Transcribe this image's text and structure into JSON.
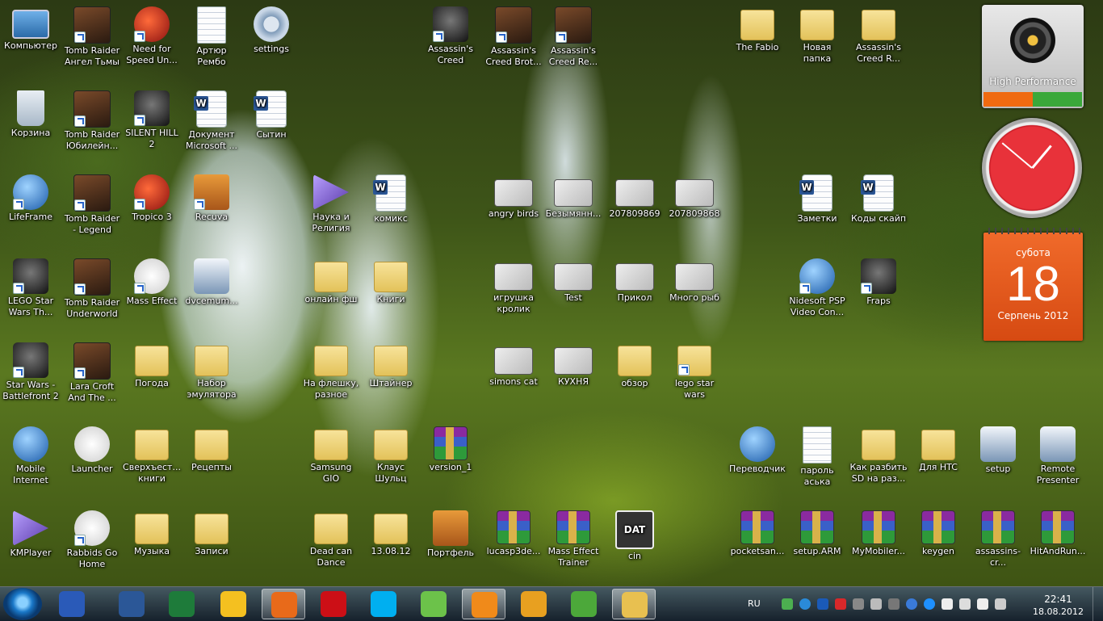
{
  "desktop_icons": [
    {
      "label": "Компьютер",
      "kind": "pc",
      "icon": "computer-icon",
      "shortcut": false
    },
    {
      "label": "Tomb Raider Ангел Тьмы",
      "kind": "game",
      "icon": "game-icon",
      "shortcut": true
    },
    {
      "label": "Need for Speed Un...",
      "kind": "red",
      "icon": "nfs-icon",
      "shortcut": true
    },
    {
      "label": "Артюр Рембо",
      "kind": "doc",
      "icon": "text-document-icon",
      "shortcut": false
    },
    {
      "label": "settings",
      "kind": "gear",
      "icon": "settings-file-icon",
      "shortcut": false
    },
    {
      "label": "Корзина",
      "kind": "trash",
      "icon": "recycle-bin-icon",
      "shortcut": false
    },
    {
      "label": "Tomb Raider Юбилейн...",
      "kind": "game",
      "icon": "game-icon",
      "shortcut": true
    },
    {
      "label": "SILENT HILL 2",
      "kind": "dark",
      "icon": "game-icon",
      "shortcut": true
    },
    {
      "label": "Документ Microsoft ...",
      "kind": "word",
      "icon": "word-document-icon",
      "shortcut": false
    },
    {
      "label": "Сытин",
      "kind": "word",
      "icon": "word-document-icon",
      "shortcut": false
    },
    {
      "label": "LifeFrame",
      "kind": "app",
      "icon": "lifeframe-icon",
      "shortcut": true
    },
    {
      "label": "Tomb Raider - Legend",
      "kind": "game",
      "icon": "game-icon",
      "shortcut": true
    },
    {
      "label": "Tropico 3",
      "kind": "red",
      "icon": "tropico-icon",
      "shortcut": true
    },
    {
      "label": "Recuva",
      "kind": "cart",
      "icon": "recuva-icon",
      "shortcut": true
    },
    {
      "label": "Наука и Религия",
      "kind": "purple",
      "icon": "djvu-icon",
      "shortcut": false
    },
    {
      "label": "комикс",
      "kind": "word",
      "icon": "word-document-icon",
      "shortcut": false
    },
    {
      "label": "LEGO Star Wars Th...",
      "kind": "dark",
      "icon": "game-icon",
      "shortcut": true
    },
    {
      "label": "Tomb Raider Underworld",
      "kind": "game",
      "icon": "game-icon",
      "shortcut": true
    },
    {
      "label": "Mass Effect",
      "kind": "white",
      "icon": "mass-effect-icon",
      "shortcut": true
    },
    {
      "label": "dvcemum...",
      "kind": "shell",
      "icon": "emulator-icon",
      "shortcut": false
    },
    {
      "label": "онлайн фш",
      "kind": "folder",
      "icon": "folder-icon",
      "shortcut": false
    },
    {
      "label": "Книги",
      "kind": "folder",
      "icon": "folder-icon",
      "shortcut": false
    },
    {
      "label": "Star Wars - Battlefront 2",
      "kind": "dark",
      "icon": "game-icon",
      "shortcut": true
    },
    {
      "label": "Lara Croft And The ...",
      "kind": "game",
      "icon": "game-icon",
      "shortcut": true
    },
    {
      "label": "Погода",
      "kind": "folder",
      "icon": "folder-icon",
      "shortcut": false
    },
    {
      "label": "Набор эмулятора",
      "kind": "folder",
      "icon": "folder-icon",
      "shortcut": false
    },
    {
      "label": "На флешку, разное",
      "kind": "folder",
      "icon": "folder-icon",
      "shortcut": false
    },
    {
      "label": "Штайнер",
      "kind": "folder",
      "icon": "folder-icon",
      "shortcut": false
    },
    {
      "label": "Mobile Internet",
      "kind": "app",
      "icon": "globe-icon",
      "shortcut": false
    },
    {
      "label": "Launcher",
      "kind": "white",
      "icon": "launcher-icon",
      "shortcut": false
    },
    {
      "label": "Сверхъест... книги",
      "kind": "folder",
      "icon": "folder-icon",
      "shortcut": false
    },
    {
      "label": "Рецепты",
      "kind": "folder",
      "icon": "folder-icon",
      "shortcut": false
    },
    {
      "label": "Samsung GIO",
      "kind": "folder",
      "icon": "folder-icon",
      "shortcut": false
    },
    {
      "label": "Клаус Шульц",
      "kind": "folder",
      "icon": "folder-icon",
      "shortcut": false
    },
    {
      "label": "version_1",
      "kind": "rar",
      "icon": "rar-archive-icon",
      "shortcut": false
    },
    {
      "label": "KMPlayer",
      "kind": "purple",
      "icon": "kmplayer-icon",
      "shortcut": false
    },
    {
      "label": "Rabbids Go Home",
      "kind": "white",
      "icon": "rabbids-icon",
      "shortcut": true
    },
    {
      "label": "Музыка",
      "kind": "folder",
      "icon": "folder-icon",
      "shortcut": false
    },
    {
      "label": "Записи",
      "kind": "folder",
      "icon": "folder-icon",
      "shortcut": false
    },
    {
      "label": "Dead can Dance",
      "kind": "folder",
      "icon": "folder-icon",
      "shortcut": false
    },
    {
      "label": "13.08.12",
      "kind": "folder",
      "icon": "folder-icon",
      "shortcut": false
    },
    {
      "label": "Портфель",
      "kind": "cart",
      "icon": "briefcase-icon",
      "shortcut": false
    },
    {
      "label": "Assassin's Creed",
      "kind": "dark",
      "icon": "ubisoft-icon",
      "shortcut": true
    },
    {
      "label": "Assassin's Creed Brot...",
      "kind": "game",
      "icon": "game-icon",
      "shortcut": true
    },
    {
      "label": "Assassin's Creed Re...",
      "kind": "game",
      "icon": "game-icon",
      "shortcut": true
    },
    {
      "label": "angry birds",
      "kind": "img",
      "icon": "image-icon",
      "shortcut": false
    },
    {
      "label": "Безымянн...",
      "kind": "img",
      "icon": "image-icon",
      "shortcut": false
    },
    {
      "label": "207809869",
      "kind": "img",
      "icon": "image-icon",
      "shortcut": false
    },
    {
      "label": "207809868",
      "kind": "img",
      "icon": "image-icon",
      "shortcut": false
    },
    {
      "label": "игрушка кролик",
      "kind": "img",
      "icon": "image-icon",
      "shortcut": false
    },
    {
      "label": "Test",
      "kind": "img",
      "icon": "image-icon",
      "shortcut": false
    },
    {
      "label": "Прикол",
      "kind": "img",
      "icon": "image-icon",
      "shortcut": false
    },
    {
      "label": "Много рыб",
      "kind": "img",
      "icon": "image-icon",
      "shortcut": false
    },
    {
      "label": "simons cat",
      "kind": "img",
      "icon": "image-icon",
      "shortcut": false
    },
    {
      "label": "КУХНЯ",
      "kind": "img",
      "icon": "image-icon",
      "shortcut": false
    },
    {
      "label": "обзор",
      "kind": "folder",
      "icon": "folder-icon",
      "shortcut": false
    },
    {
      "label": "lego star wars",
      "kind": "folder",
      "icon": "folder-icon",
      "shortcut": true
    },
    {
      "label": "lucasp3de...",
      "kind": "rar",
      "icon": "rar-archive-icon",
      "shortcut": false
    },
    {
      "label": "Mass Effect Trainer",
      "kind": "rar",
      "icon": "rar-archive-icon",
      "shortcut": false
    },
    {
      "label": "cin",
      "kind": "dat",
      "icon": "dat-file-icon",
      "shortcut": false
    },
    {
      "label": "The Fabio",
      "kind": "folder",
      "icon": "folder-icon",
      "shortcut": false
    },
    {
      "label": "Новая папка",
      "kind": "folder",
      "icon": "folder-icon",
      "shortcut": false
    },
    {
      "label": "Assassin's Creed R...",
      "kind": "folder",
      "icon": "folder-icon",
      "shortcut": false
    },
    {
      "label": "Заметки",
      "kind": "word",
      "icon": "word-document-icon",
      "shortcut": false
    },
    {
      "label": "Коды скайп",
      "kind": "word",
      "icon": "word-document-icon",
      "shortcut": false
    },
    {
      "label": "Nidesoft PSP Video Con...",
      "kind": "app",
      "icon": "video-converter-icon",
      "shortcut": true
    },
    {
      "label": "Fraps",
      "kind": "dark",
      "icon": "fraps-icon",
      "shortcut": true
    },
    {
      "label": "Переводчик",
      "kind": "app",
      "icon": "translator-icon",
      "shortcut": false
    },
    {
      "label": "пароль аська",
      "kind": "doc",
      "icon": "text-document-icon",
      "shortcut": false
    },
    {
      "label": "Как разбить SD на раз...",
      "kind": "folder",
      "icon": "folder-icon",
      "shortcut": false
    },
    {
      "label": "Для HTC",
      "kind": "folder",
      "icon": "folder-icon",
      "shortcut": false
    },
    {
      "label": "setup",
      "kind": "shell",
      "icon": "installer-icon",
      "shortcut": false
    },
    {
      "label": "Remote Presenter",
      "kind": "shell",
      "icon": "installer-icon",
      "shortcut": false
    },
    {
      "label": "pocketsan...",
      "kind": "rar",
      "icon": "rar-archive-icon",
      "shortcut": false
    },
    {
      "label": "setup.ARM",
      "kind": "rar",
      "icon": "rar-archive-icon",
      "shortcut": false
    },
    {
      "label": "MyMobiler...",
      "kind": "rar",
      "icon": "rar-archive-icon",
      "shortcut": false
    },
    {
      "label": "keygen",
      "kind": "rar",
      "icon": "rar-archive-icon",
      "shortcut": false
    },
    {
      "label": "assassins-cr...",
      "kind": "rar",
      "icon": "rar-archive-icon",
      "shortcut": false
    },
    {
      "label": "HitAndRun...",
      "kind": "rar",
      "icon": "rar-archive-icon",
      "shortcut": false
    }
  ],
  "gadgets": {
    "performance": {
      "title": "High Performance"
    },
    "calendar": {
      "day_of_week": "субота",
      "day": "18",
      "month_year": "Серпень 2012"
    }
  },
  "taskbar": {
    "pinned": [
      {
        "name": "save-disk",
        "color": "#2a5ab8",
        "active": false
      },
      {
        "name": "word",
        "color": "#2b5797",
        "active": false
      },
      {
        "name": "excel",
        "color": "#1e7b3a",
        "active": false
      },
      {
        "name": "google-drive",
        "color": "#f4c020",
        "active": false
      },
      {
        "name": "firefox",
        "color": "#e86a1a",
        "active": true
      },
      {
        "name": "opera",
        "color": "#cc0f16",
        "active": false
      },
      {
        "name": "skype",
        "color": "#00aff0",
        "active": false
      },
      {
        "name": "icq",
        "color": "#6cc24a",
        "active": false
      },
      {
        "name": "media-player",
        "color": "#f08a1a",
        "active": true
      },
      {
        "name": "winamp",
        "color": "#e8a020",
        "active": false
      },
      {
        "name": "utorrent",
        "color": "#4ca83a",
        "active": false
      },
      {
        "name": "explorer",
        "color": "#e8c050",
        "active": true
      }
    ],
    "tray": {
      "language": "RU",
      "time": "22:41",
      "date": "18.08.2012"
    }
  }
}
